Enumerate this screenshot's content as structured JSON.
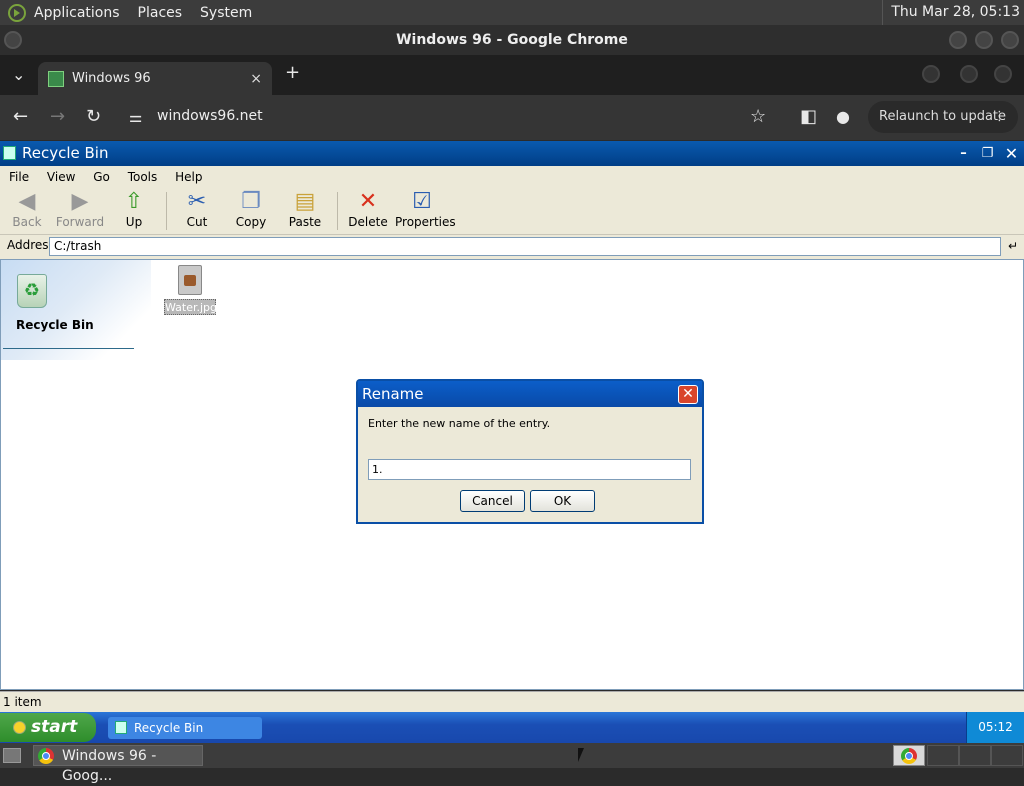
{
  "os_panel": {
    "menus": [
      "Applications",
      "Places",
      "System"
    ],
    "clock": "Thu Mar 28, 05:13"
  },
  "chrome": {
    "window_title": "Windows 96 - Google Chrome",
    "tab_title": "Windows 96",
    "url": "windows96.net",
    "relaunch_label": "Relaunch to update",
    "icons": {
      "tab_close": "×",
      "new_tab": "+",
      "tab_menu": "⌄",
      "back": "←",
      "forward": "→",
      "reload": "↻",
      "site_info": "⚌",
      "bookmark": "☆",
      "side_panel": "◧",
      "profile": "●",
      "more": "⋮"
    }
  },
  "explorer": {
    "title": "Recycle Bin",
    "menu": [
      "File",
      "View",
      "Go",
      "Tools",
      "Help"
    ],
    "toolbar": {
      "back": "Back",
      "forward": "Forward",
      "up": "Up",
      "cut": "Cut",
      "copy": "Copy",
      "paste": "Paste",
      "delete": "Delete",
      "properties": "Properties"
    },
    "address_label": "Address",
    "address": "C:/trash",
    "pane_title": "Recycle Bin",
    "file_name": "Water.jpg",
    "status": "1 item"
  },
  "dialog": {
    "title": "Rename",
    "message": "Enter the new name of the entry.",
    "input_value": "1.",
    "cancel": "Cancel",
    "ok": "OK"
  },
  "w96_taskbar": {
    "start": "start",
    "task": "Recycle Bin",
    "clock": "05:12"
  },
  "os_taskbar": {
    "task": "Windows 96 - Goog..."
  }
}
